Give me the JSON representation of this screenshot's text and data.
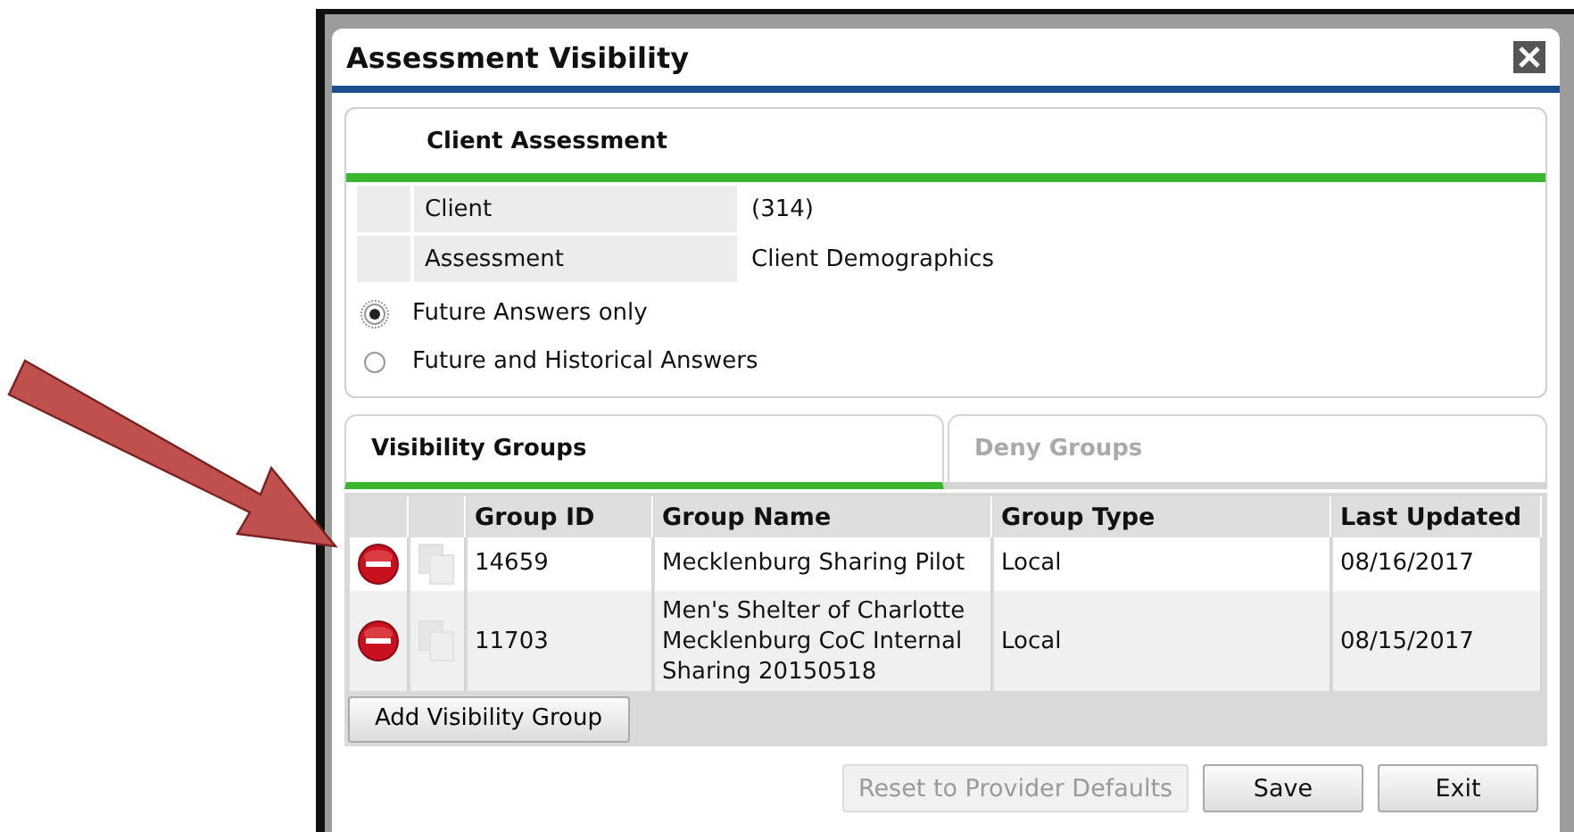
{
  "dialog": {
    "title": "Assessment Visibility"
  },
  "client_assessment": {
    "title": "Client Assessment",
    "fields": [
      {
        "label": "Client",
        "value": "(314)"
      },
      {
        "label": "Assessment",
        "value": "Client Demographics"
      }
    ],
    "options": [
      {
        "label": "Future Answers only",
        "selected": true
      },
      {
        "label": "Future and Historical Answers",
        "selected": false
      }
    ]
  },
  "tabs": [
    {
      "label": "Visibility Groups",
      "selected": true
    },
    {
      "label": "Deny Groups",
      "selected": false
    }
  ],
  "table": {
    "columns": [
      "Group ID",
      "Group Name",
      "Group Type",
      "Last Updated"
    ],
    "rows": [
      {
        "cells": [
          "14659",
          "Mecklenburg Sharing Pilot",
          "Local",
          "08/16/2017"
        ]
      },
      {
        "cells": [
          "11703",
          "Men's Shelter of Charlotte Mecklenburg CoC Internal Sharing 20150518",
          "Local",
          "08/15/2017"
        ]
      }
    ]
  },
  "add_button": "Add Visibility Group",
  "buttons": [
    {
      "label": "Reset to Provider Defaults",
      "disabled": true
    },
    {
      "label": "Save",
      "disabled": false
    },
    {
      "label": "Exit",
      "disabled": false
    }
  ]
}
